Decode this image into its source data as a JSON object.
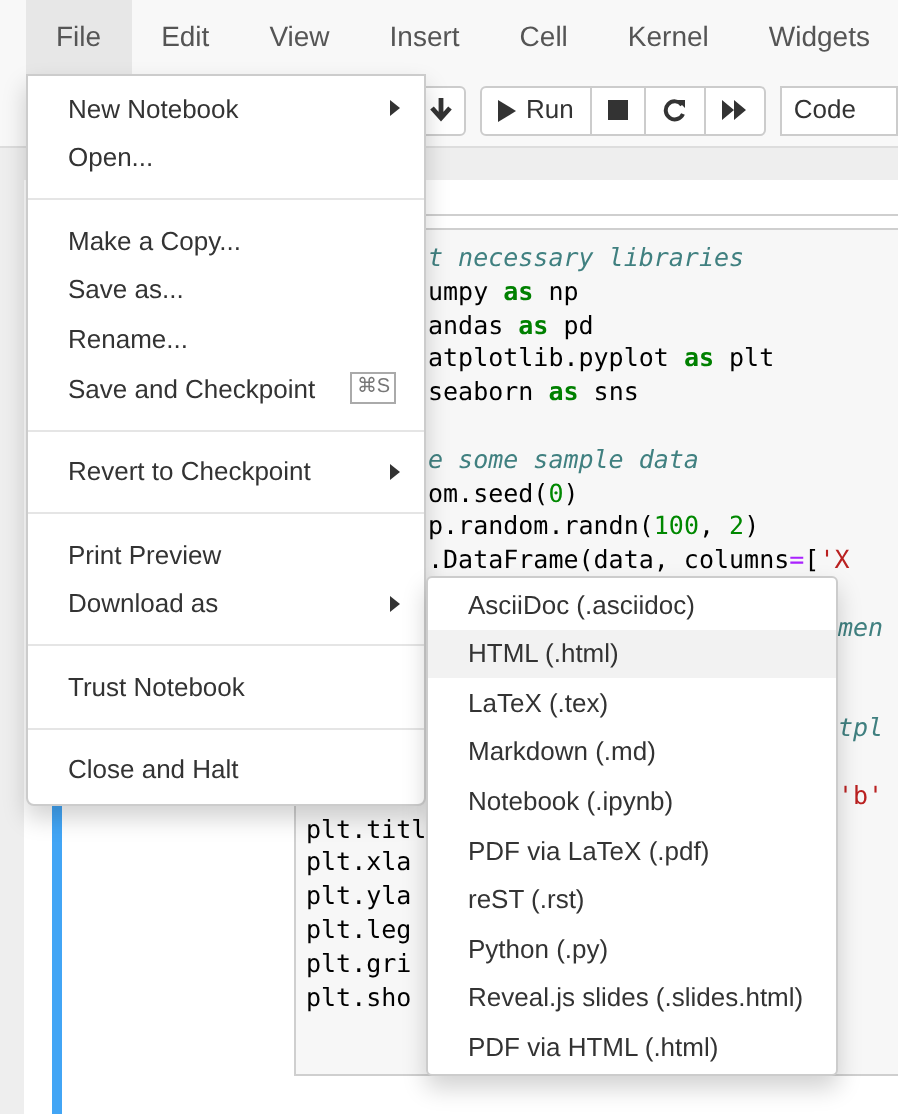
{
  "menu_bar": [
    {
      "label": "File",
      "selected": true
    },
    {
      "label": "Edit",
      "selected": false
    },
    {
      "label": "View",
      "selected": false
    },
    {
      "label": "Insert",
      "selected": false
    },
    {
      "label": "Cell",
      "selected": false
    },
    {
      "label": "Kernel",
      "selected": false
    },
    {
      "label": "Widgets",
      "selected": false
    }
  ],
  "toolbar": {
    "run_label": "Run",
    "cell_type": "Code"
  },
  "code_lines": [
    {
      "kind": "code",
      "middle": [
        {
          "kind": "comment",
          "text": "t necessary libraries"
        }
      ]
    },
    {
      "kind": "code",
      "middle": [
        {
          "kind": "plain",
          "text": "umpy "
        },
        {
          "kind": "keyword",
          "text": "as"
        },
        {
          "kind": "plain",
          "text": " np"
        }
      ]
    },
    {
      "kind": "code",
      "middle": [
        {
          "kind": "plain",
          "text": "andas "
        },
        {
          "kind": "keyword",
          "text": "as"
        },
        {
          "kind": "plain",
          "text": " pd"
        }
      ]
    },
    {
      "kind": "code",
      "middle": [
        {
          "kind": "plain",
          "text": "atplotlib.pyplot "
        },
        {
          "kind": "keyword",
          "text": "as"
        },
        {
          "kind": "plain",
          "text": " plt"
        }
      ]
    },
    {
      "kind": "code",
      "middle": [
        {
          "kind": "plain",
          "text": "seaborn "
        },
        {
          "kind": "keyword",
          "text": "as"
        },
        {
          "kind": "plain",
          "text": " sns"
        }
      ]
    },
    {
      "kind": "blank"
    },
    {
      "kind": "code",
      "middle": [
        {
          "kind": "comment",
          "text": "e some sample data"
        }
      ]
    },
    {
      "kind": "code",
      "middle": [
        {
          "kind": "plain",
          "text": "om.seed("
        },
        {
          "kind": "number",
          "text": "0"
        },
        {
          "kind": "plain",
          "text": ")"
        }
      ]
    },
    {
      "kind": "code",
      "middle": [
        {
          "kind": "plain",
          "text": "p.random.randn("
        },
        {
          "kind": "number",
          "text": "100"
        },
        {
          "kind": "plain",
          "text": ", "
        },
        {
          "kind": "number",
          "text": "2"
        },
        {
          "kind": "plain",
          "text": ")"
        }
      ]
    },
    {
      "kind": "code",
      "middle": [
        {
          "kind": "plain",
          "text": ".DataFrame(data, columns"
        },
        {
          "kind": "operator",
          "text": "="
        },
        {
          "kind": "plain",
          "text": "["
        },
        {
          "kind": "string",
          "text": "'X"
        }
      ]
    },
    {
      "kind": "blank"
    },
    {
      "kind": "code",
      "right": [
        {
          "kind": "comment",
          "text": "men"
        }
      ]
    },
    {
      "kind": "blank"
    },
    {
      "kind": "blank"
    },
    {
      "kind": "code",
      "right": [
        {
          "kind": "comment",
          "text": "tpl"
        }
      ]
    },
    {
      "kind": "blank"
    },
    {
      "kind": "code",
      "right": [
        {
          "kind": "string",
          "text": "'b'"
        }
      ]
    },
    {
      "kind": "code",
      "left": [
        {
          "kind": "plain",
          "text": "plt.titl"
        }
      ]
    },
    {
      "kind": "code",
      "left": [
        {
          "kind": "plain",
          "text": "plt.xla"
        }
      ]
    },
    {
      "kind": "code",
      "left": [
        {
          "kind": "plain",
          "text": "plt.yla"
        }
      ]
    },
    {
      "kind": "code",
      "left": [
        {
          "kind": "plain",
          "text": "plt.leg"
        }
      ]
    },
    {
      "kind": "code",
      "left": [
        {
          "kind": "plain",
          "text": "plt.gri"
        }
      ]
    },
    {
      "kind": "code",
      "left": [
        {
          "kind": "plain",
          "text": "plt.sho"
        }
      ]
    }
  ],
  "file_menu": [
    {
      "kind": "item",
      "label": "New Notebook",
      "submenu": true
    },
    {
      "kind": "item",
      "label": "Open..."
    },
    {
      "kind": "separator"
    },
    {
      "kind": "item",
      "label": "Make a Copy..."
    },
    {
      "kind": "item",
      "label": "Save as..."
    },
    {
      "kind": "item",
      "label": "Rename..."
    },
    {
      "kind": "item",
      "label": "Save and Checkpoint",
      "shortcut": "⌘S"
    },
    {
      "kind": "separator"
    },
    {
      "kind": "item",
      "label": "Revert to Checkpoint",
      "submenu": true
    },
    {
      "kind": "separator"
    },
    {
      "kind": "item",
      "label": "Print Preview"
    },
    {
      "kind": "item",
      "label": "Download as",
      "submenu": true
    },
    {
      "kind": "separator"
    },
    {
      "kind": "item",
      "label": "Trust Notebook"
    },
    {
      "kind": "separator"
    },
    {
      "kind": "item",
      "label": "Close and Halt"
    }
  ],
  "download_submenu": [
    {
      "label": "AsciiDoc (.asciidoc)",
      "selected": false
    },
    {
      "label": "HTML (.html)",
      "selected": true
    },
    {
      "label": "LaTeX (.tex)",
      "selected": false
    },
    {
      "label": "Markdown (.md)",
      "selected": false
    },
    {
      "label": "Notebook (.ipynb)",
      "selected": false
    },
    {
      "label": "PDF via LaTeX (.pdf)",
      "selected": false
    },
    {
      "label": "reST (.rst)",
      "selected": false
    },
    {
      "label": "Python (.py)",
      "selected": false
    },
    {
      "label": "Reveal.js slides (.slides.html)",
      "selected": false
    },
    {
      "label": "PDF via HTML (.html)",
      "selected": false
    }
  ]
}
